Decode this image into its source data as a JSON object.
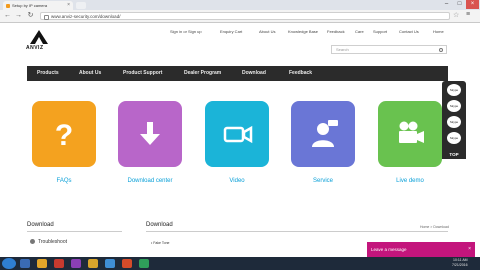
{
  "browser": {
    "tab_title": "Setup by IP camera",
    "url": "www.anviz-security.com/download/"
  },
  "site": {
    "logo": "ANVIZ",
    "toplinks": [
      "Sign in or Sign up",
      "Enquiry Cart",
      "About Us",
      "Knowledge Base",
      "Feedback",
      "Care",
      "Support",
      "Contact Us",
      "Home"
    ],
    "search_placeholder": "Search",
    "nav": [
      "Products",
      "About Us",
      "Product Support",
      "Dealer Program",
      "Download",
      "Feedback"
    ],
    "tiles": [
      {
        "label": "FAQs",
        "color": "#f4a21f",
        "icon": "question-icon"
      },
      {
        "label": "Download center",
        "color": "#b866c9",
        "icon": "download-arrow-icon"
      },
      {
        "label": "Video",
        "color": "#1bb4d8",
        "icon": "video-camera-icon"
      },
      {
        "label": "Service",
        "color": "#6a76d6",
        "icon": "support-agent-icon"
      },
      {
        "label": "Live demo",
        "color": "#69c24f",
        "icon": "movie-camera-icon"
      }
    ],
    "float_buttons": [
      "Skype",
      "Skype",
      "Skype",
      "Skype"
    ],
    "float_top": "TOP",
    "left_heading": "Download",
    "troubleshoot": "Troubleshoot",
    "main_heading": "Download",
    "breadcrumb": "Home > Download",
    "faq_item": "• Fake Tone"
  },
  "chat": {
    "label": "Leave a message",
    "close": "×"
  },
  "taskbar": {
    "time": "10:11 AM",
    "date": "7/21/2016"
  }
}
